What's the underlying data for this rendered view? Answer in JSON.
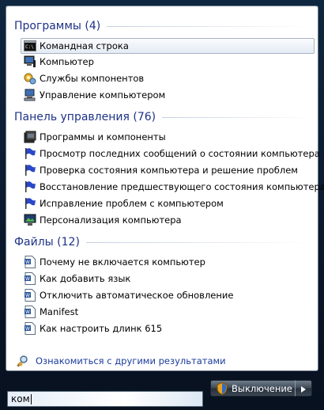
{
  "groups": [
    {
      "title": "Программы (4)",
      "items": [
        {
          "label": "Командная строка",
          "icon": "cmd-icon"
        },
        {
          "label": "Компьютер",
          "icon": "computer-icon"
        },
        {
          "label": "Службы компонентов",
          "icon": "component-services-icon"
        },
        {
          "label": "Управление компьютером",
          "icon": "computer-management-icon"
        }
      ]
    },
    {
      "title": "Панель управления (76)",
      "items": [
        {
          "label": "Программы и компоненты",
          "icon": "programs-icon"
        },
        {
          "label": "Просмотр последних сообщений о состоянии компьютера",
          "icon": "flag-icon"
        },
        {
          "label": "Проверка состояния компьютера и решение проблем",
          "icon": "flag-icon"
        },
        {
          "label": "Восстановление предшествующего состояния компьютера",
          "icon": "flag-icon"
        },
        {
          "label": "Исправление проблем с компьютером",
          "icon": "flag-icon"
        },
        {
          "label": "Персонализация компьютера",
          "icon": "personalization-icon"
        }
      ]
    },
    {
      "title": "Файлы (12)",
      "items": [
        {
          "label": "Почему не включается компьютер",
          "icon": "word-doc-icon"
        },
        {
          "label": "Как добавить язык",
          "icon": "word-doc-icon"
        },
        {
          "label": "Отключить автоматическое обновление",
          "icon": "word-doc-icon"
        },
        {
          "label": "Manifest",
          "icon": "word-doc-icon"
        },
        {
          "label": "Как настроить длинк 615",
          "icon": "word-doc-icon"
        }
      ]
    }
  ],
  "more_results": {
    "label": "Ознакомиться с другими результатами",
    "icon": "search-more-icon"
  },
  "search": {
    "value": "ком"
  },
  "shutdown": {
    "label": "Выключение",
    "icon": "shield-icon"
  },
  "arrow": {
    "icon": "arrow-right-icon"
  },
  "colors": {
    "group_title": "#1e3287",
    "link": "#1a3b9c",
    "flag": "#2a48c8"
  }
}
